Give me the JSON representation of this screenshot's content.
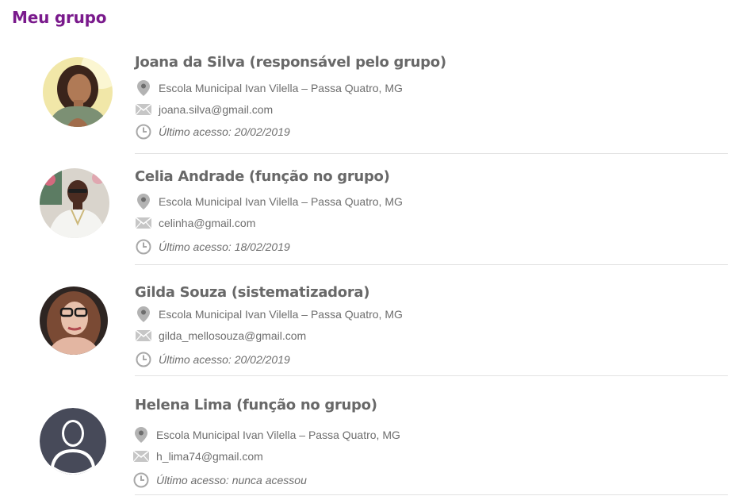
{
  "page": {
    "title": "Meu grupo"
  },
  "members": [
    {
      "name": "Joana da Silva (responsável pelo grupo)",
      "school": "Escola Municipal Ivan Vilella – Passa Quatro, MG",
      "email": "joana.silva@gmail.com",
      "last_access": "Último acesso: 20/02/2019",
      "avatar": "photo"
    },
    {
      "name": "Celia Andrade (função no grupo)",
      "school": "Escola Municipal Ivan Vilella – Passa Quatro, MG",
      "email": "celinha@gmail.com",
      "last_access": "Último acesso: 18/02/2019",
      "avatar": "photo"
    },
    {
      "name": "Gilda Souza (sistematizadora)",
      "school": "Escola Municipal Ivan Vilella – Passa Quatro, MG",
      "email": "gilda_mellosouza@gmail.com",
      "last_access": "Último acesso: 20/02/2019",
      "avatar": "photo"
    },
    {
      "name": "Helena Lima (função no grupo)",
      "school": "Escola Municipal Ivan Vilella – Passa Quatro, MG",
      "email": "h_lima74@gmail.com",
      "last_access": "Último acesso: nunca acessou",
      "avatar": "default-user-icon"
    }
  ],
  "icons": {
    "location": "location-pin-icon",
    "email": "envelope-icon",
    "clock": "clock-icon"
  },
  "colors": {
    "title": "#7a1a8c",
    "text": "#6e6e6e",
    "icon": "#b0b0b0"
  }
}
